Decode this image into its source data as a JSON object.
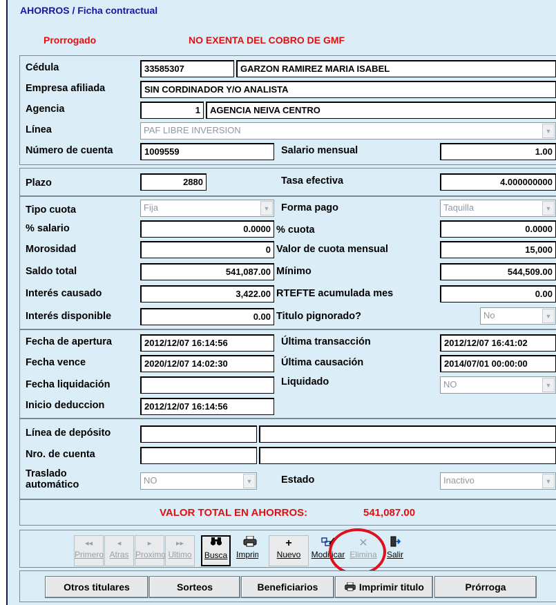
{
  "header": {
    "title": "AHORROS / Ficha contractual",
    "status": "Prorrogado",
    "gmf_notice": "NO EXENTA DEL COBRO DE GMF"
  },
  "client": {
    "cedula_label": "Cédula",
    "cedula": "33585307",
    "name": "GARZON RAMIREZ MARIA ISABEL",
    "empresa_label": "Empresa afiliada",
    "empresa": "SIN CORDINADOR Y/O ANALISTA",
    "agencia_label": "Agencia",
    "agencia_code": "1",
    "agencia_name": "AGENCIA NEIVA CENTRO",
    "linea_label": "Línea",
    "linea": "PAF LIBRE INVERSION",
    "cuenta_label": "Número de cuenta",
    "cuenta": "1009559",
    "salario_label": "Salario mensual",
    "salario": "1.00"
  },
  "plazo": {
    "plazo_label": "Plazo",
    "plazo": "2880",
    "tasa_label": "Tasa efectiva",
    "tasa": "4.000000000"
  },
  "cuota": {
    "tipo_cuota_label": "Tipo cuota",
    "tipo_cuota": "Fija",
    "forma_pago_label": "Forma pago",
    "forma_pago": "Taquilla",
    "pct_salario_label": "% salario",
    "pct_salario": "0.0000",
    "pct_cuota_label": "% cuota",
    "pct_cuota": "0.0000",
    "morosidad_label": "Morosidad",
    "morosidad": "0",
    "valor_cuota_label": "Valor de cuota mensual",
    "valor_cuota": "15,000",
    "saldo_label": "Saldo total",
    "saldo": "541,087.00",
    "minimo_label": "Mínimo",
    "minimo": "544,509.00",
    "interes_causado_label": "Interés causado",
    "interes_causado": "3,422.00",
    "rtefte_label": "RTEFTE acumulada mes",
    "rtefte": "0.00",
    "interes_disp_label": "Interés disponible",
    "interes_disp": "0.00",
    "pignorado_label": "Titulo pignorado?",
    "pignorado": "No"
  },
  "fechas": {
    "apertura_label": "Fecha de apertura",
    "apertura": "2012/12/07 16:14:56",
    "ult_trans_label": "Última transacción",
    "ult_trans": "2012/12/07 16:41:02",
    "vence_label": "Fecha vence",
    "vence": "2020/12/07 14:02:30",
    "ult_caus_label": "Última causación",
    "ult_caus": "2014/07/01 00:00:00",
    "liquidacion_label": "Fecha liquidación",
    "liquidacion": "",
    "liquidado_label": "Liquidado",
    "liquidado": "NO",
    "inicio_label": "Inicio deduccion",
    "inicio": "2012/12/07 16:14:56"
  },
  "deposito": {
    "linea_label": "Línea de depósito",
    "nro_label": "Nro. de cuenta",
    "traslado_label_1": "Traslado",
    "traslado_label_2": "automático",
    "traslado": "NO",
    "estado_label": "Estado",
    "estado": "Inactivo"
  },
  "total": {
    "label": "VALOR TOTAL EN AHORROS:",
    "value": "541,087.00"
  },
  "nav": [
    {
      "label": "Primero",
      "icon": "◂◂"
    },
    {
      "label": "Atras",
      "icon": "◂"
    },
    {
      "label": "Proximo",
      "icon": "▸"
    },
    {
      "label": "Ultimo",
      "icon": "▸▸"
    },
    {
      "label": "Busca",
      "icon": "binoculars-icon"
    },
    {
      "label": "Imprimir",
      "icon": "printer-icon"
    },
    {
      "label": "Nuevo",
      "icon": "plus-icon"
    },
    {
      "label": "Modificar",
      "icon": "edit-icon"
    },
    {
      "label": "Elimina",
      "icon": "delete-icon"
    },
    {
      "label": "Salir",
      "icon": "exit-door-icon"
    }
  ],
  "actions": {
    "otros_titulares": "Otros titulares",
    "sorteos": "Sorteos",
    "beneficiarios": "Beneficiarios",
    "imprimir_titulo": "Imprimir titulo",
    "prorroga": "Prórroga"
  },
  "colors": {
    "background": "#dbeef8",
    "title_blue": "#1515a8",
    "alert_red": "#e01010",
    "highlight_circle": "#e0101a"
  }
}
